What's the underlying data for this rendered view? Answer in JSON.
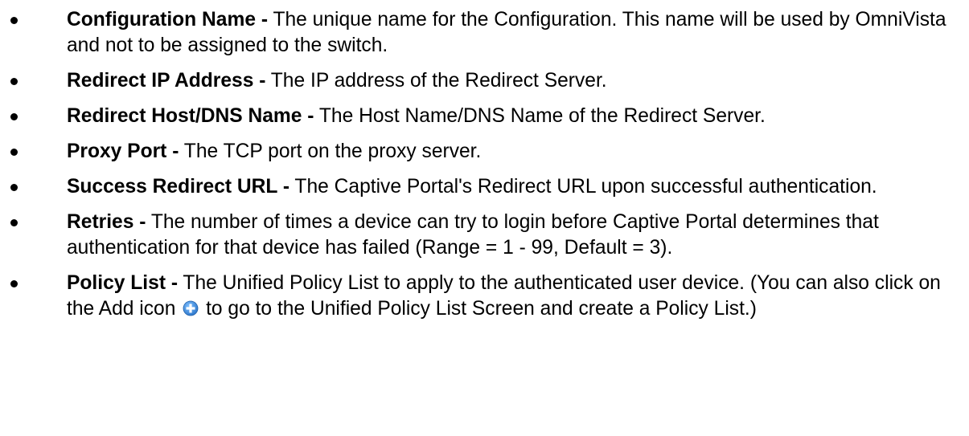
{
  "items": [
    {
      "term": "Configuration Name -",
      "desc": "The unique name for the Configuration. This name will be used by OmniVista and not to be assigned to the switch."
    },
    {
      "term": "Redirect IP Address -",
      "desc": "The IP address of the Redirect Server."
    },
    {
      "term": "Redirect Host/DNS Name -",
      "desc": "The Host Name/DNS Name of the Redirect Server."
    },
    {
      "term": "Proxy Port -",
      "desc": "The TCP port on the proxy server."
    },
    {
      "term": "Success Redirect URL -",
      "desc": "The Captive Portal's Redirect URL upon successful authentication."
    },
    {
      "term": "Retries -",
      "desc": "The number of times a device can try to login before Captive Portal determines that authentication for that device has failed (Range = 1 - 99, Default = 3)."
    },
    {
      "term": "Policy List -",
      "desc_before_icon": "The Unified Policy List to apply to the authenticated user device. (You can also click on the Add icon",
      "desc_after_icon": "to go to the Unified Policy List Screen and create a Policy List.)",
      "icon": "add-icon"
    }
  ],
  "colors": {
    "text": "#000000",
    "add_icon_fill": "#3d8fe0",
    "add_icon_plus": "#ffffff"
  }
}
